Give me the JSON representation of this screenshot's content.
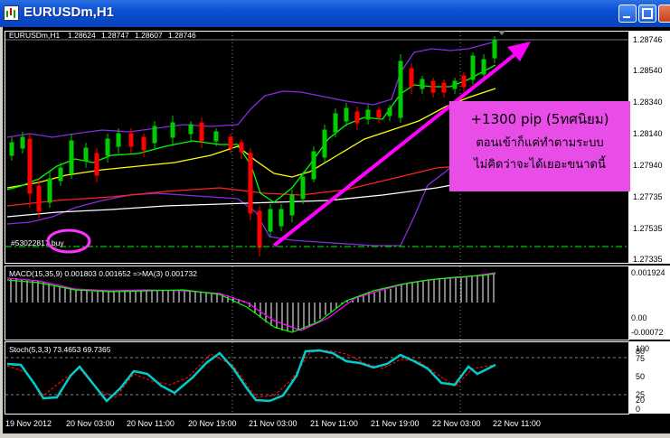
{
  "window": {
    "title": "EURUSDm,H1"
  },
  "chart_header": {
    "symbol": "EURUSDm,H1",
    "open": "1.28624",
    "high": "1.28747",
    "low": "1.28607",
    "close": "1.28746"
  },
  "price_labels": [
    "1.28746",
    "1.28540",
    "1.28340",
    "1.28140",
    "1.27940",
    "1.27735",
    "1.27535",
    "1.27335"
  ],
  "order_label": "#53022817 buy",
  "macd": {
    "label": "MACD(15,35,9) 0.001803 0.001652 =>MA(3) 0.001732",
    "labels": [
      "0.001924",
      "0.00",
      "-0.00072"
    ]
  },
  "stoch": {
    "label": "Stoch(5,3,3) 73.4653 69.7365",
    "labels": [
      "100",
      "80",
      "75",
      "50",
      "25",
      "20",
      "0"
    ]
  },
  "time_labels": [
    "19 Nov 2012",
    "20 Nov 03:00",
    "20 Nov 11:00",
    "20 Nov 19:00",
    "21 Nov 03:00",
    "21 Nov 11:00",
    "21 Nov 19:00",
    "22 Nov 03:00",
    "22 Nov 11:00"
  ],
  "annotation": {
    "line1": "+1300 pip (5ทศนิยม)",
    "line2": "ตอนเข้าก็แค่ทำตามระบบ",
    "line3": "ไม่คิดว่าจะได้เยอะขนาดนี้"
  },
  "colors": {
    "bull": "#00cc00",
    "bear": "#ff0000",
    "bands": "#8a2be2",
    "ma_fast": "#00ff00",
    "ma_yellow": "#ffff00",
    "ma_red": "#ff0000",
    "ma_white": "#ffffff",
    "arrow": "#ff00ff",
    "note_bg": "#e84de8",
    "stoch_main": "#00cccc",
    "stoch_signal": "#ff0000"
  }
}
